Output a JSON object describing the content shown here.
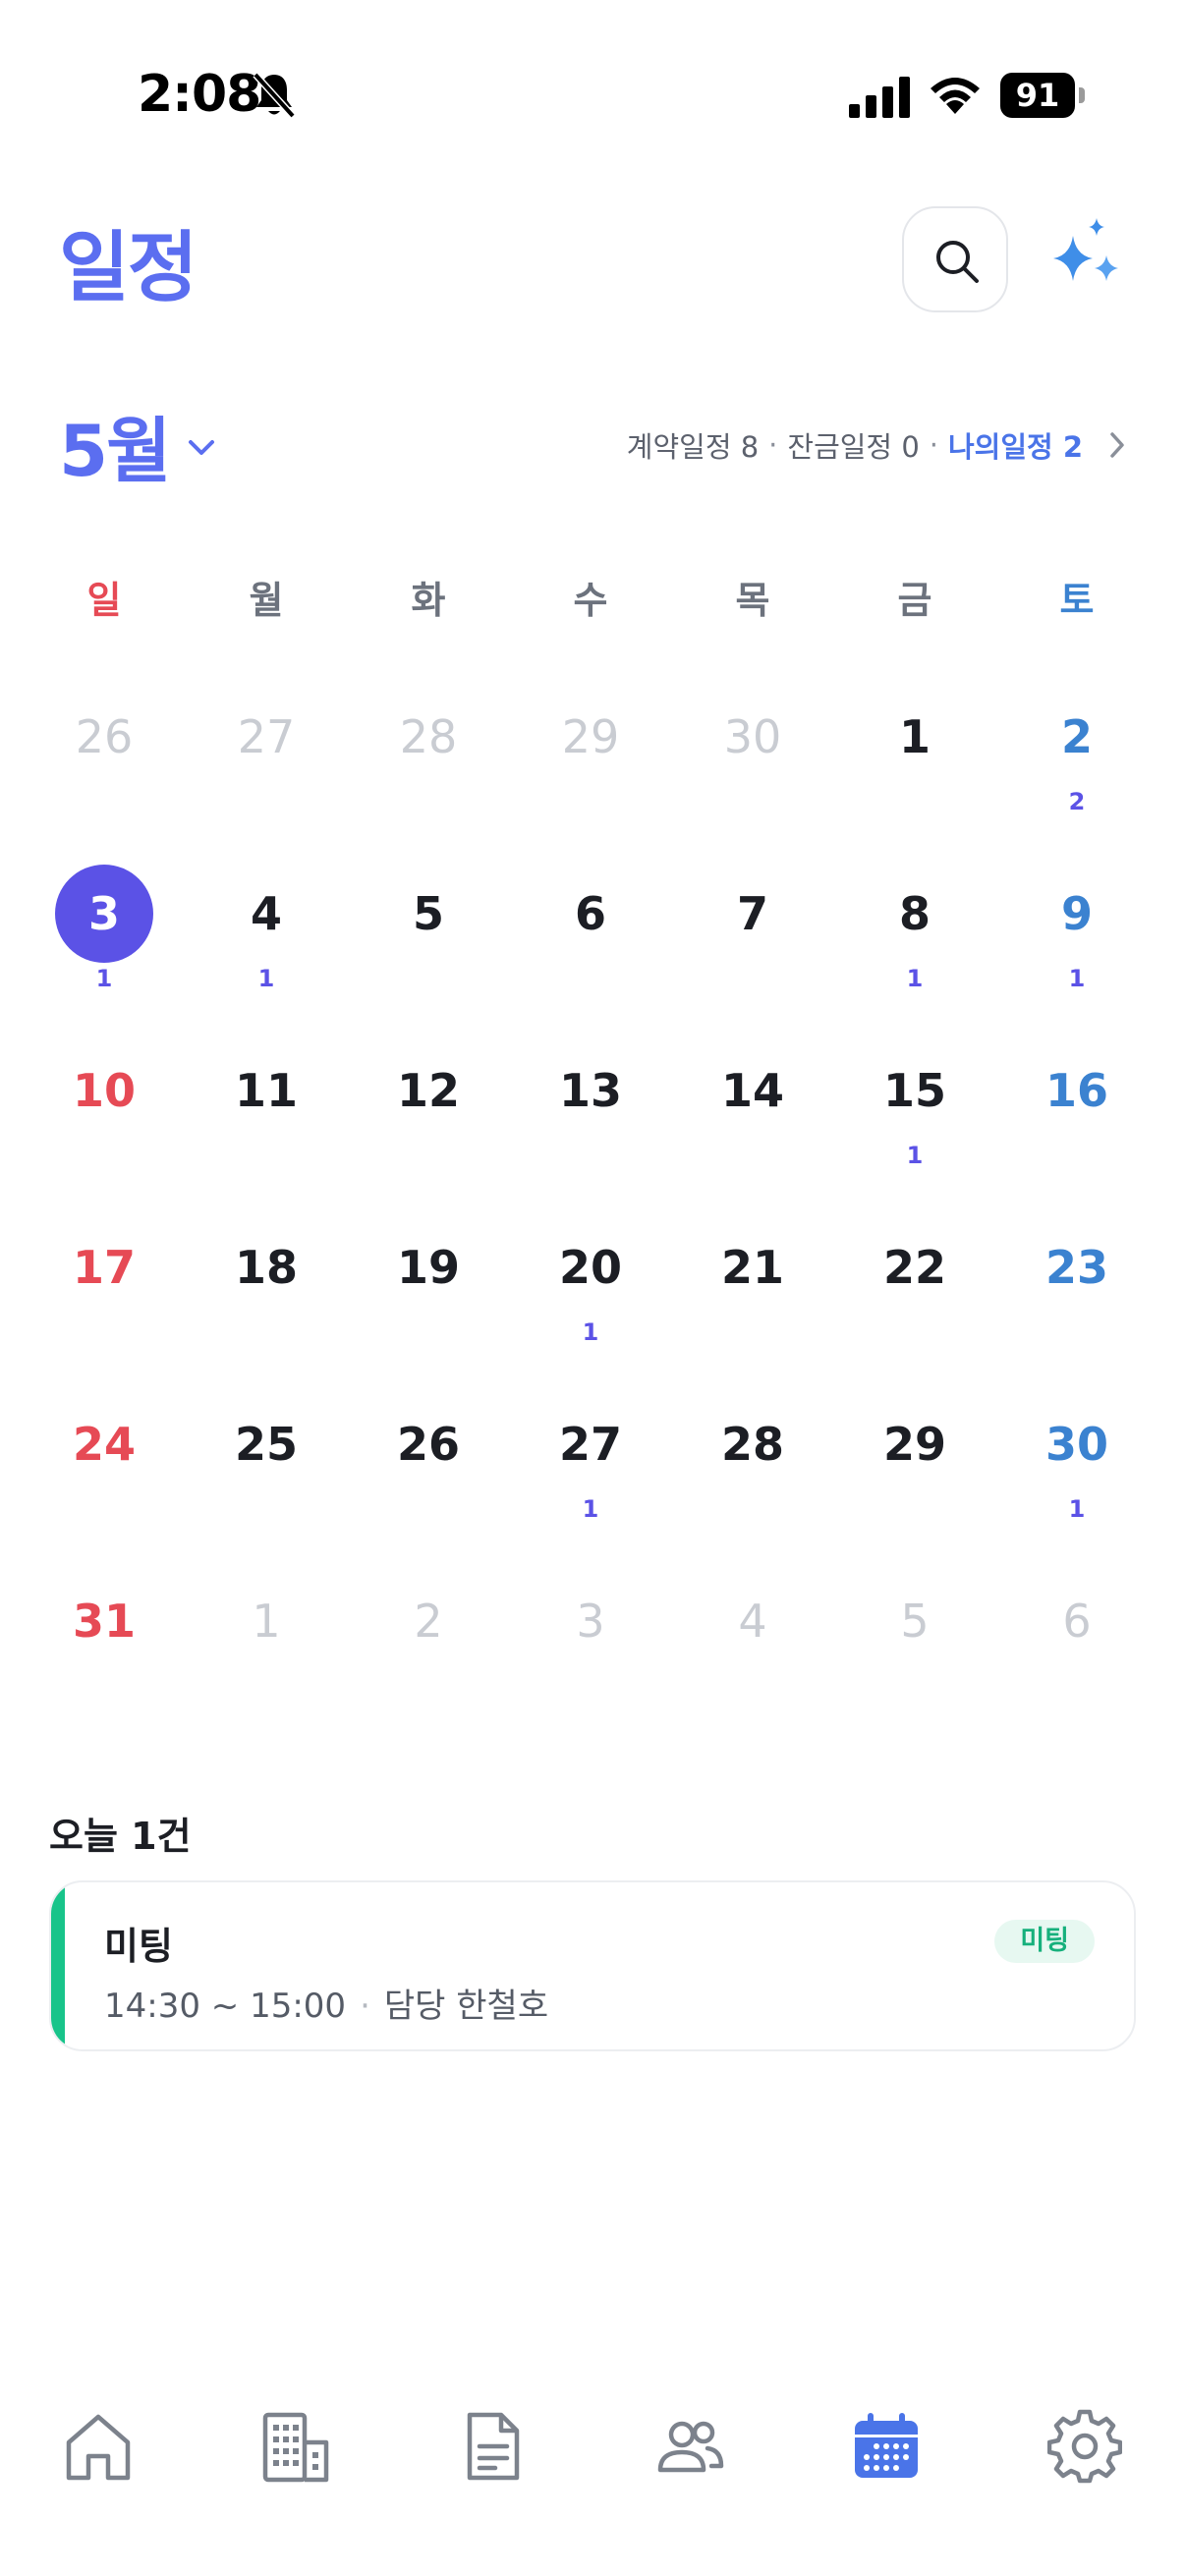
{
  "status_bar": {
    "time": "2:08",
    "battery": "91"
  },
  "header": {
    "title": "일정"
  },
  "month": {
    "label": "5월"
  },
  "summary": {
    "contract": "계약일정 8",
    "balance": "잔금일정 0",
    "mine": "나의일정 2",
    "separator": "·"
  },
  "weekdays": [
    "일",
    "월",
    "화",
    "수",
    "목",
    "금",
    "토"
  ],
  "weeks": [
    [
      {
        "day": "26",
        "count": "",
        "other": true
      },
      {
        "day": "27",
        "count": "",
        "other": true
      },
      {
        "day": "28",
        "count": "",
        "other": true
      },
      {
        "day": "29",
        "count": "",
        "other": true
      },
      {
        "day": "30",
        "count": "",
        "other": true
      },
      {
        "day": "1",
        "count": ""
      },
      {
        "day": "2",
        "count": "2"
      }
    ],
    [
      {
        "day": "3",
        "count": "1",
        "today": true
      },
      {
        "day": "4",
        "count": "1"
      },
      {
        "day": "5",
        "count": ""
      },
      {
        "day": "6",
        "count": ""
      },
      {
        "day": "7",
        "count": ""
      },
      {
        "day": "8",
        "count": "1"
      },
      {
        "day": "9",
        "count": "1"
      }
    ],
    [
      {
        "day": "10",
        "count": ""
      },
      {
        "day": "11",
        "count": ""
      },
      {
        "day": "12",
        "count": ""
      },
      {
        "day": "13",
        "count": ""
      },
      {
        "day": "14",
        "count": ""
      },
      {
        "day": "15",
        "count": "1"
      },
      {
        "day": "16",
        "count": ""
      }
    ],
    [
      {
        "day": "17",
        "count": ""
      },
      {
        "day": "18",
        "count": ""
      },
      {
        "day": "19",
        "count": ""
      },
      {
        "day": "20",
        "count": "1"
      },
      {
        "day": "21",
        "count": ""
      },
      {
        "day": "22",
        "count": ""
      },
      {
        "day": "23",
        "count": ""
      }
    ],
    [
      {
        "day": "24",
        "count": ""
      },
      {
        "day": "25",
        "count": ""
      },
      {
        "day": "26",
        "count": ""
      },
      {
        "day": "27",
        "count": "1"
      },
      {
        "day": "28",
        "count": ""
      },
      {
        "day": "29",
        "count": ""
      },
      {
        "day": "30",
        "count": "1"
      }
    ],
    [
      {
        "day": "31",
        "count": ""
      },
      {
        "day": "1",
        "count": "",
        "other": true
      },
      {
        "day": "2",
        "count": "",
        "other": true
      },
      {
        "day": "3",
        "count": "",
        "other": true
      },
      {
        "day": "4",
        "count": "",
        "other": true
      },
      {
        "day": "5",
        "count": "",
        "other": true
      },
      {
        "day": "6",
        "count": "",
        "other": true
      }
    ]
  ],
  "today": {
    "heading": "오늘 1건",
    "event": {
      "title": "미팅",
      "time": "14:30 ~ 15:00",
      "separator": "·",
      "owner": "담당 한철호",
      "badge": "미팅"
    }
  },
  "tab_bar": {
    "items": [
      {
        "icon": "home-icon"
      },
      {
        "icon": "building-icon"
      },
      {
        "icon": "document-icon"
      },
      {
        "icon": "people-icon"
      },
      {
        "icon": "calendar-icon",
        "active": true
      },
      {
        "icon": "gear-icon"
      }
    ]
  },
  "colors": {
    "accent": "#5b6ef0",
    "today_circle": "#5b52e6",
    "sunday": "#e64a55",
    "saturday": "#3b82d0",
    "event_accent": "#18c48a"
  }
}
